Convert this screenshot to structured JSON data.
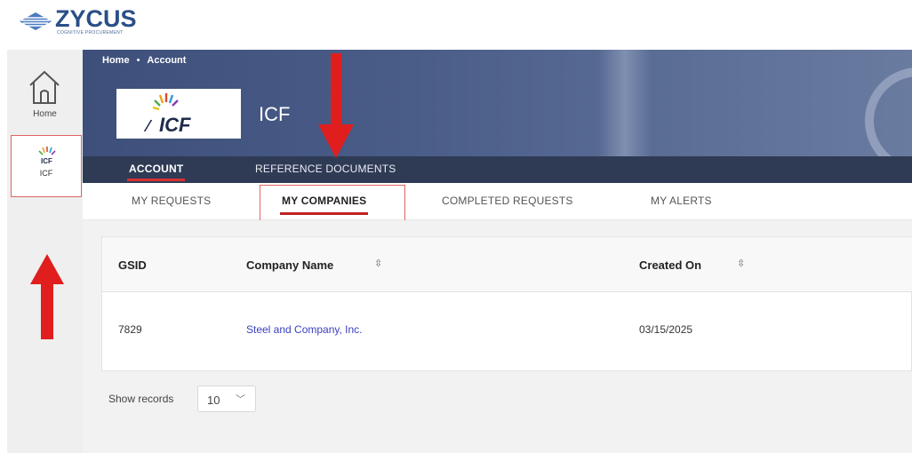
{
  "brand": {
    "name": "ZYCUS",
    "tagline": "COGNITIVE PROCUREMENT"
  },
  "sidebar": {
    "items": [
      {
        "label": "Home",
        "icon": "home-icon"
      },
      {
        "label": "ICF",
        "icon": "icf-logo-icon"
      }
    ]
  },
  "header": {
    "breadcrumb": {
      "home": "Home",
      "separator": "•",
      "current": "Account"
    },
    "account_name": "ICF",
    "logo_text": "ICF",
    "tabs": [
      {
        "label": "ACCOUNT",
        "active": true
      },
      {
        "label": "REFERENCE DOCUMENTS",
        "active": false
      }
    ]
  },
  "subtabs": [
    {
      "label": "MY REQUESTS",
      "active": false
    },
    {
      "label": "MY COMPANIES",
      "active": true
    },
    {
      "label": "COMPLETED REQUESTS",
      "active": false
    },
    {
      "label": "MY ALERTS",
      "active": false
    }
  ],
  "table": {
    "columns": [
      {
        "label": "GSID",
        "sortable": false
      },
      {
        "label": "Company Name",
        "sortable": true
      },
      {
        "label": "Created On",
        "sortable": true
      }
    ],
    "rows": [
      {
        "gsid": "7829",
        "company_name": "Steel and Company, Inc.",
        "created_on": "03/15/2025"
      }
    ]
  },
  "pagination": {
    "label": "Show records",
    "value": "10"
  },
  "colors": {
    "accent": "#c02222",
    "banner": "#3d4f7a",
    "tab_bar": "#2f3b55",
    "link": "#3a3fbf",
    "annotation": "#e02020"
  }
}
